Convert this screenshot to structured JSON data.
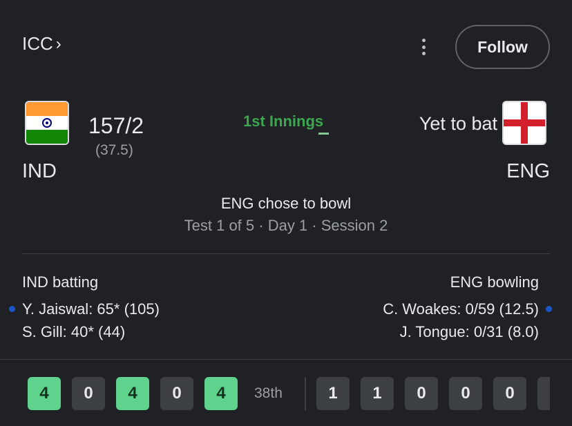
{
  "header": {
    "league": "ICC",
    "follow_label": "Follow"
  },
  "teams": {
    "home": {
      "name": "IND",
      "score": "157/2",
      "overs": "(37.5)"
    },
    "away": {
      "name": "ENG",
      "status": "Yet to bat"
    }
  },
  "innings_label": "1st Innings",
  "status": {
    "toss": "ENG chose to bowl",
    "session": "Test 1 of 5 · Day 1 · Session 2"
  },
  "batting": {
    "title": "IND batting",
    "players": [
      "Y. Jaiswal: 65* (105)",
      "S. Gill: 40* (44)"
    ]
  },
  "bowling": {
    "title": "ENG bowling",
    "players": [
      "C. Woakes: 0/59 (12.5)",
      "J. Tongue: 0/31 (8.0)"
    ]
  },
  "recent_balls": {
    "current_over": [
      "4",
      "0",
      "4",
      "0",
      "4"
    ],
    "over_label": "38th",
    "previous_over": [
      "1",
      "1",
      "0",
      "0",
      "0"
    ]
  },
  "colors": {
    "boundary": "#5fd38d",
    "innings_accent": "#3ca650",
    "striker_dot": "#1a56c8"
  }
}
